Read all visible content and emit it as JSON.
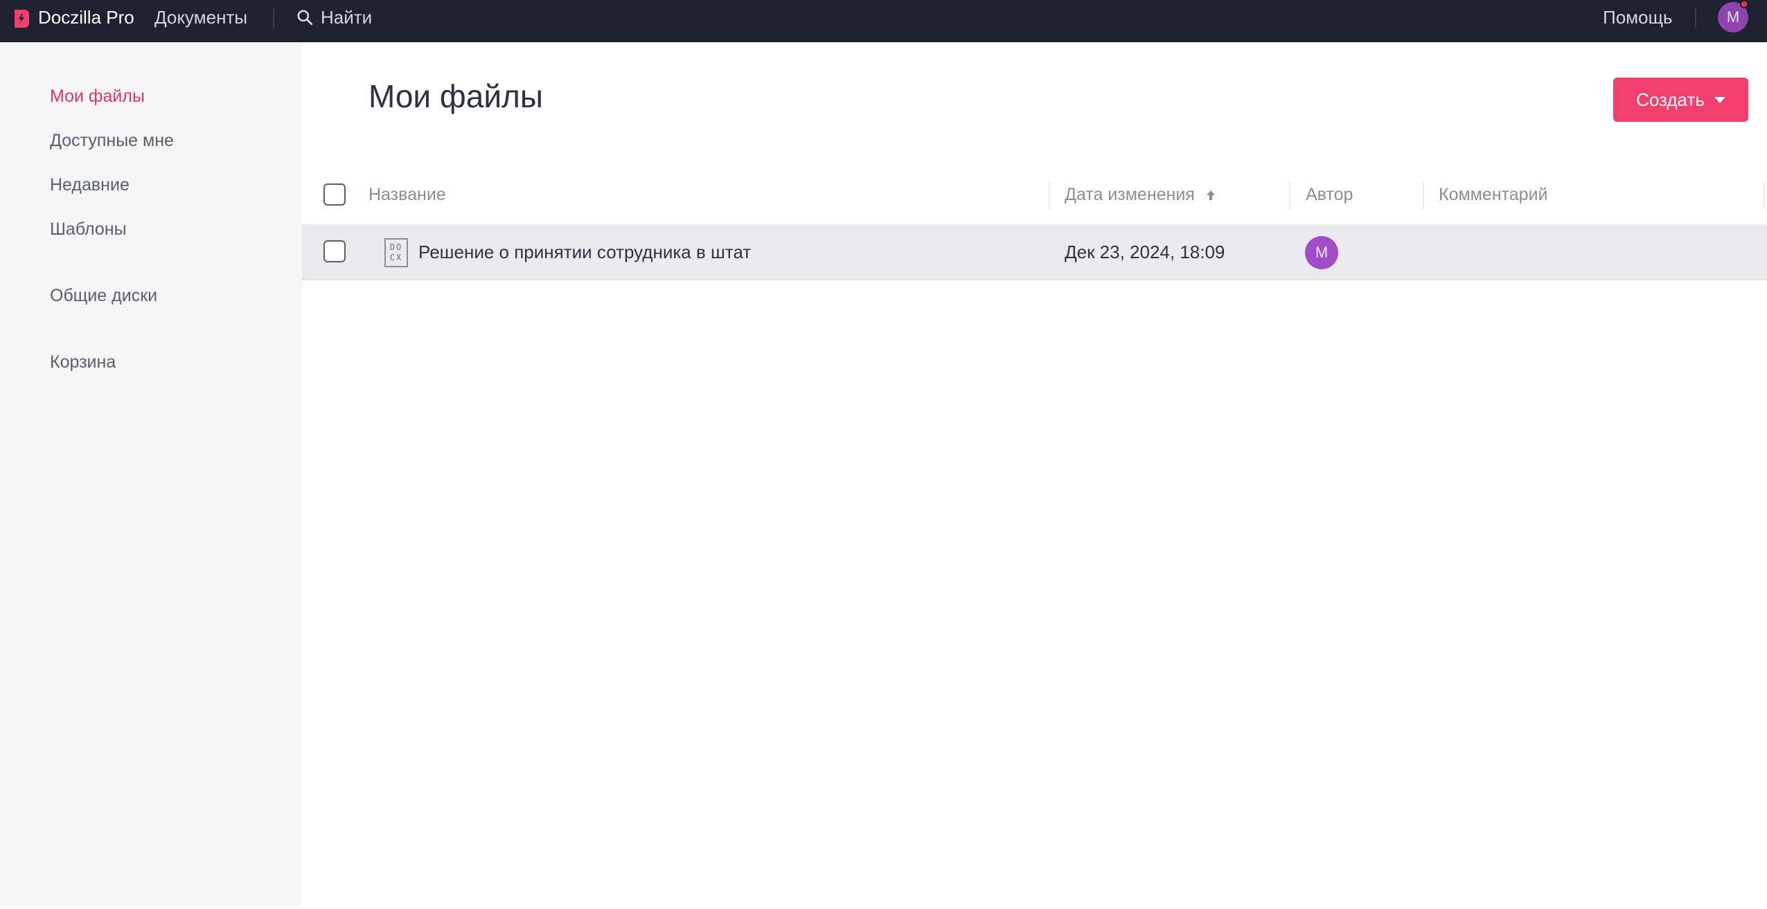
{
  "topbar": {
    "brand": "Doczilla Pro",
    "documents_label": "Документы",
    "search_label": "Найти",
    "help_label": "Помощь",
    "user_initial": "M"
  },
  "sidebar": {
    "items": [
      {
        "label": "Мои файлы",
        "active": true
      },
      {
        "label": "Доступные мне",
        "active": false
      },
      {
        "label": "Недавние",
        "active": false
      },
      {
        "label": "Шаблоны",
        "active": false
      },
      {
        "label": "Общие диски",
        "active": false
      },
      {
        "label": "Корзина",
        "active": false
      }
    ]
  },
  "main": {
    "title": "Мои файлы",
    "create_label": "Создать",
    "columns": {
      "name": "Название",
      "modified": "Дата изменения",
      "author": "Автор",
      "comment": "Комментарий"
    },
    "rows": [
      {
        "file_type": "DOCX",
        "file_type_line1": "DO",
        "file_type_line2": "CX",
        "name": "Решение о принятии сотрудника в штат",
        "modified": "Дек 23, 2024, 18:09",
        "author_initial": "M",
        "comment": ""
      }
    ]
  },
  "colors": {
    "topbar_bg": "#1e2130",
    "accent": "#f23f6d",
    "active_nav": "#e0365f",
    "avatar": "#a24bc9"
  }
}
